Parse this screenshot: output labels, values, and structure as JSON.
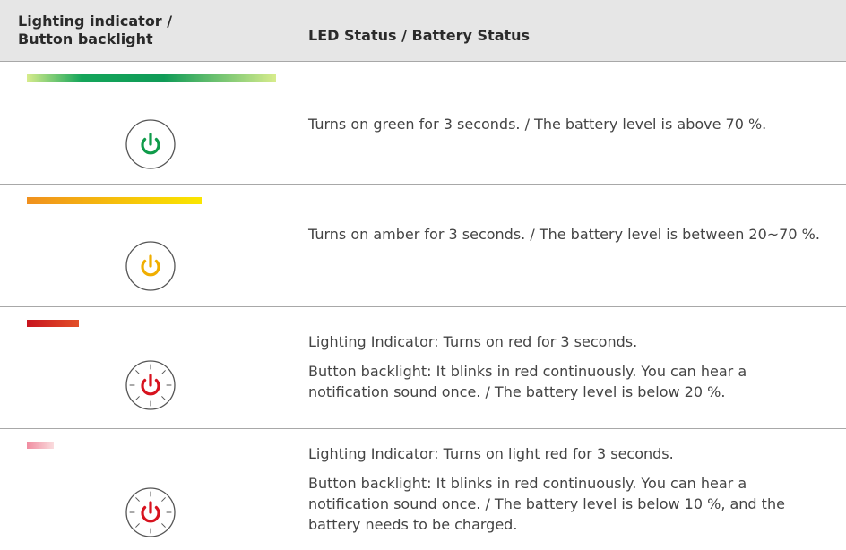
{
  "header": {
    "col1_line1": "Lighting indicator /",
    "col1_line2": "Button backlight",
    "col2": "LED Status / Battery Status"
  },
  "rows": [
    {
      "bar_gradient": [
        "#d7ec8c",
        "#14a55a",
        "#0f9b57",
        "#d7ec8c"
      ],
      "icon": "power-icon-green",
      "icon_color": "#0f9b4a",
      "text1": "Turns on green for 3 seconds. / The battery level is above 70 %."
    },
    {
      "bar_gradient": [
        "#f0901e",
        "#f6c20a",
        "#fae600"
      ],
      "icon": "power-icon-amber",
      "icon_color": "#f0ae00",
      "text1": "Turns on amber for 3 seconds. / The battery level is between 20~70 %."
    },
    {
      "bar_gradient": [
        "#c8141e",
        "#e24f28"
      ],
      "icon": "power-icon-red-blinking",
      "icon_color": "#d7121e",
      "text1": "Lighting Indicator: Turns on red for 3 seconds.",
      "text2": "Button backlight: It blinks in red continuously. You can hear a notification sound once. / The battery level is below 20 %."
    },
    {
      "bar_gradient": [
        "#f08ca0",
        "#fadcde"
      ],
      "icon": "power-icon-red-blinking",
      "icon_color": "#d7121e",
      "text1": "Lighting Indicator: Turns on light red for 3 seconds.",
      "text2": "Button backlight: It blinks in red continuously. You can hear a notification sound once. / The battery level is below 10 %, and the battery needs to be charged."
    }
  ]
}
